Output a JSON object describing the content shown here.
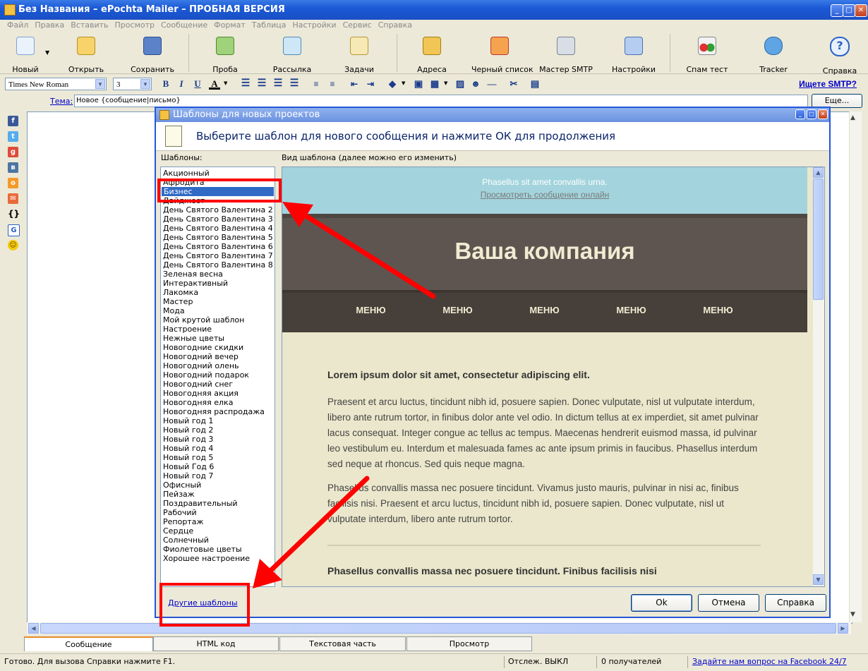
{
  "window": {
    "title": "Без Названия – ePochta Mailer – ПРОБНАЯ ВЕРСИЯ"
  },
  "menu": [
    "Файл",
    "Правка",
    "Вставить",
    "Просмотр",
    "Сообщение",
    "Формат",
    "Таблица",
    "Настройки",
    "Сервис",
    "Справка"
  ],
  "toolbar": {
    "new": "Новый",
    "open": "Открыть",
    "save": "Сохранить",
    "test": "Проба",
    "send": "Рассылка",
    "tasks": "Задачи",
    "addresses": "Адреса",
    "blacklist": "Черный список",
    "smtp_wizard": "Мастер SMTP",
    "settings": "Настройки",
    "spam_test": "Спам тест",
    "tracker": "Tracker",
    "help": "Справка"
  },
  "format": {
    "font": "Times New Roman",
    "size": "3",
    "bold": "B",
    "italic": "I",
    "underline": "U",
    "font_color": "A",
    "smtp_link": "Ищете SMTP?"
  },
  "subject": {
    "label": "Тема:",
    "value": "Новое {сообщение|письмо}",
    "more": "Еще..."
  },
  "dialog": {
    "title": "Шаблоны для новых проектов",
    "header": "Выберите шаблон для нового сообщения и нажмите ОК для продолжения",
    "templates_label": "Шаблоны:",
    "preview_label": "Вид шаблона (далее можно его изменить)",
    "templates": [
      "Акционный",
      "Афродита",
      "Бизнес",
      "Дайджест",
      "День Святого Валентина 2",
      "День Святого Валентина 3",
      "День Святого Валентина 4",
      "День Святого Валентина 5",
      "День Святого Валентина 6",
      "День Святого Валентина 7",
      "День Святого Валентина 8",
      "Зеленая весна",
      "Интерактивный",
      "Лакомка",
      "Мастер",
      "Мода",
      "Мой крутой шаблон",
      "Настроение",
      "Нежные цветы",
      "Новогодние скидки",
      "Новогодний вечер",
      "Новогодний олень",
      "Новогодний подарок",
      "Новогодний снег",
      "Новогодняя акция",
      "Новогодняя елка",
      "Новогодняя распродажа",
      "Новый год 1",
      "Новый год 2",
      "Новый год 3",
      "Новый год 4",
      "Новый год 5",
      "Новый Год 6",
      "Новый год 7",
      "Офисный",
      "Пейзаж",
      "Поздравительный",
      "Рабочий",
      "Репортаж",
      "Сердце",
      "Солнечный",
      "Фиолетовые цветы",
      "Хорошее настроение"
    ],
    "selected_index": 2,
    "other_templates": "Другие шаблоны",
    "ok": "Ok",
    "cancel": "Отмена",
    "help": "Справка"
  },
  "preview": {
    "pre_header": "Phasellus sit amet convallis urna.",
    "view_online": "Просмотреть сообщение онлайн",
    "company": "Ваша компания",
    "menu": [
      "МЕНЮ",
      "МЕНЮ",
      "МЕНЮ",
      "МЕНЮ",
      "МЕНЮ"
    ],
    "heading1": "Lorem ipsum dolor sit amet, consectetur adipiscing elit.",
    "para1": "Praesent et arcu luctus, tincidunt nibh id, posuere sapien. Donec vulputate, nisl ut vulputate interdum, libero ante rutrum tortor, in finibus dolor ante vel odio. In dictum tellus at ex imperdiet, sit amet pulvinar lacus consequat. Integer congue ac tellus ac tempus. Maecenas hendrerit euismod massa, id pulvinar leo vestibulum eu. Interdum et malesuada fames ac ante ipsum primis in faucibus. Phasellus interdum sed neque at rhoncus. Sed quis neque magna.",
    "para2": "Phasellus convallis massa nec posuere tincidunt. Vivamus justo mauris, pulvinar in nisi ac, finibus facilisis nisi. Praesent et arcu luctus, tincidunt nibh id, posuere sapien. Donec vulputate, nisl ut vulputate interdum, libero ante rutrum tortor.",
    "heading2": "Phasellus convallis massa nec posuere tincidunt. Finibus facilisis nisi"
  },
  "tabs": [
    "Сообщение",
    "HTML код",
    "Текстовая часть",
    "Просмотр"
  ],
  "status": {
    "ready": "Готово. Для вызова Справки нажмите F1.",
    "tracking": "Отслеж. ВЫКЛ",
    "recipients": "0 получателей",
    "facebook": "Задайте нам вопрос на Facebook 24/7"
  },
  "colors": {
    "titlebar": "#1B59D6",
    "selection": "#316AC5",
    "annotation": "#FF0000"
  }
}
